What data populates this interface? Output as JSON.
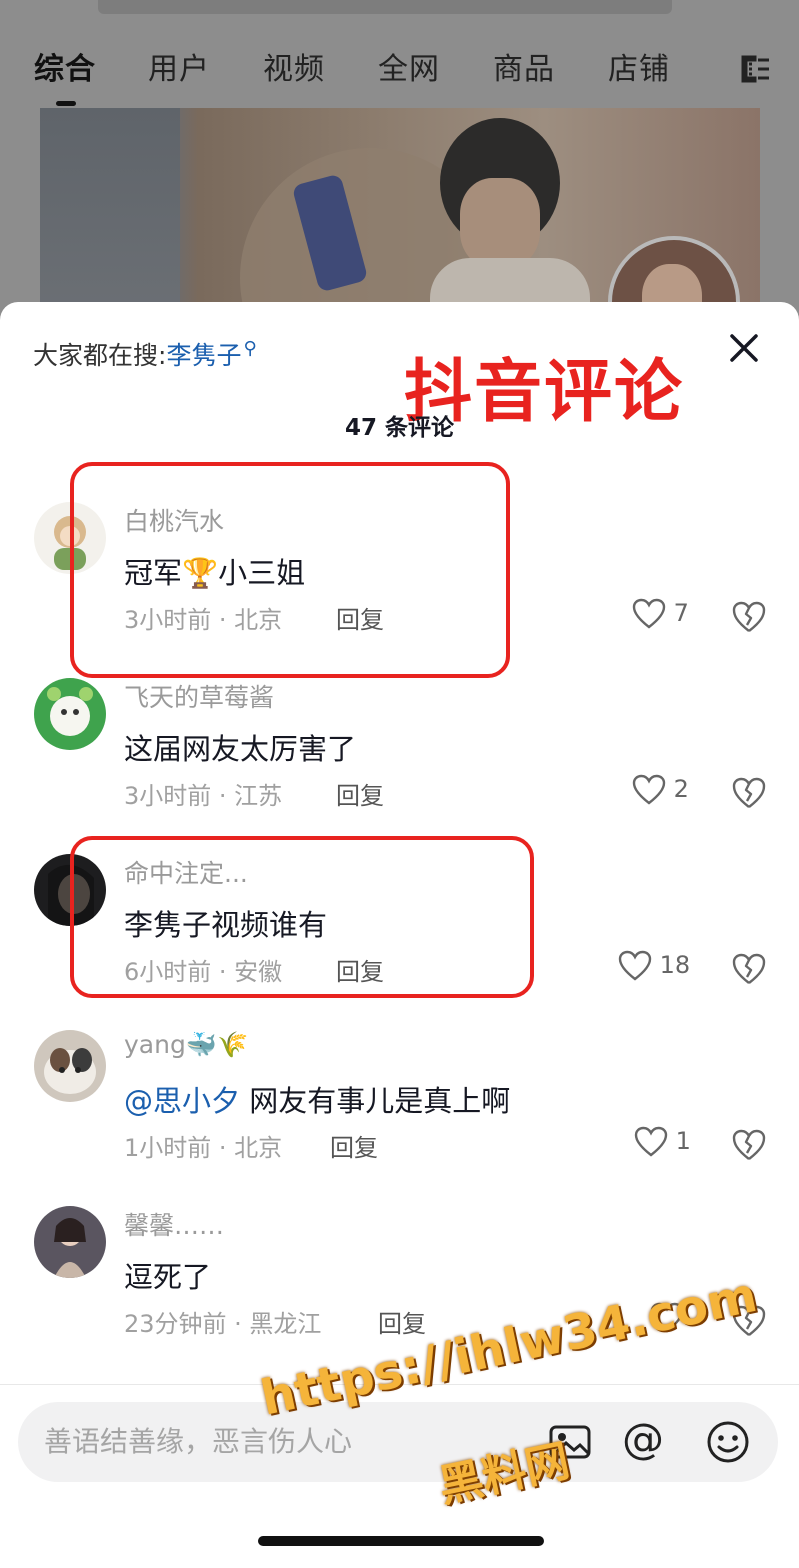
{
  "tabs": [
    "综合",
    "用户",
    "视频",
    "全网",
    "商品",
    "店铺"
  ],
  "hot_search": {
    "prefix": "大家都在搜:",
    "keyword": "李隽子"
  },
  "overlay_title": "抖音评论",
  "comment_count": "47 条评论",
  "comments": [
    {
      "user": "白桃汽水",
      "text": "冠军🏆小三姐",
      "time_loc": "3小时前 · 北京",
      "reply": "回复",
      "likes": "7"
    },
    {
      "user": "飞天的草莓酱",
      "text": "这届网友太厉害了",
      "time_loc": "3小时前 · 江苏",
      "reply": "回复",
      "likes": "2"
    },
    {
      "user": "命中注定...",
      "text": "李隽子视频谁有",
      "time_loc": "6小时前 · 安徽",
      "reply": "回复",
      "likes": "18"
    },
    {
      "user": "yang🐳🌾",
      "mention": "@思小夕",
      "text": " 网友有事儿是真上啊",
      "time_loc": "1小时前 · 北京",
      "reply": "回复",
      "likes": "1"
    },
    {
      "user": "馨馨……",
      "text": "逗死了",
      "time_loc": "23分钟前 · 黑龙江",
      "reply": "回复",
      "likes": ""
    }
  ],
  "input": {
    "placeholder": "善语结善缘，恶言伤人心"
  },
  "at_symbol": "@",
  "watermark": {
    "line1": "https://ihlw34.com",
    "line2": "黑料网"
  },
  "colors": {
    "accent_red": "#e8231f",
    "link_blue": "#1b5fae"
  }
}
